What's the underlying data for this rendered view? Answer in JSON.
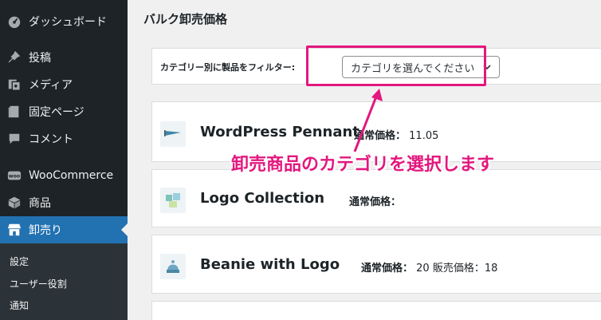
{
  "sidebar": {
    "items": [
      {
        "label": "ダッシュボード",
        "icon": "dashboard-icon"
      },
      {
        "label": "投稿",
        "icon": "pin-icon"
      },
      {
        "label": "メディア",
        "icon": "media-icon"
      },
      {
        "label": "固定ページ",
        "icon": "page-icon"
      },
      {
        "label": "コメント",
        "icon": "comment-icon"
      },
      {
        "label": "WooCommerce",
        "icon": "woo-icon"
      },
      {
        "label": "商品",
        "icon": "box-icon"
      },
      {
        "label": "卸売り",
        "icon": "store-icon"
      }
    ],
    "submenu": [
      "設定",
      "ユーザー役割",
      "通知"
    ]
  },
  "main": {
    "title": "バルク卸売価格",
    "filter": {
      "label": "カテゴリー別に製品をフィルター:",
      "select_value": "カテゴリを選んでください"
    },
    "products": [
      {
        "name": "WordPress Pennant",
        "price_label": "通常価格：",
        "price_value": "11.05",
        "sale_label": "",
        "sale_value": ""
      },
      {
        "name": "Logo Collection",
        "price_label": "通常価格：",
        "price_value": "",
        "sale_label": "",
        "sale_value": ""
      },
      {
        "name": "Beanie with Logo",
        "price_label": "通常価格：",
        "price_value": "20",
        "sale_label": "販売価格：",
        "sale_value": "18"
      }
    ]
  },
  "annotation": {
    "text": "卸売商品のカテゴリを選択します",
    "color": "#e3177e"
  },
  "colors": {
    "sidebar_bg": "#1d2327",
    "active_bg": "#2271b1",
    "content_bg": "#f0f0f1"
  }
}
